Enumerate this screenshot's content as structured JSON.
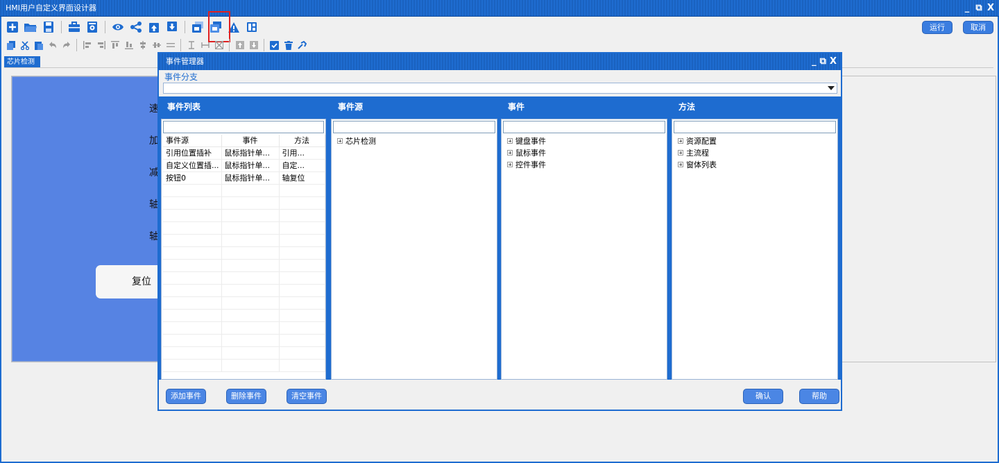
{
  "window": {
    "title": "HMI用户自定义界面设计器"
  },
  "window_controls": {
    "minimize": "_",
    "restore": "⧉",
    "close": "X"
  },
  "toolbar_top": {
    "buttons": [
      "new-icon",
      "open-folder-icon",
      "save-icon",
      "toolbox-icon",
      "document-settings-icon",
      "preview-eye-icon",
      "share-icon",
      "upload-icon",
      "download-icon",
      "layer-front-icon",
      "layer-back-icon",
      "warning-icon",
      "layout-icon"
    ]
  },
  "toolbar_bottom": {
    "buttons": [
      "copy-icon",
      "cut-icon",
      "paste-icon",
      "undo-icon",
      "redo-icon",
      "align-left-icon",
      "align-right-icon",
      "align-top-icon",
      "align-bottom-icon",
      "align-vcenter-icon",
      "align-hcenter-icon",
      "distribute-h-icon",
      "same-height-icon",
      "same-width-icon",
      "same-size-icon",
      "bring-front-icon",
      "send-back-icon",
      "checklist-icon",
      "delete-icon",
      "tools-icon"
    ]
  },
  "actions": {
    "run": "运行",
    "cancel": "取消"
  },
  "doc_tab": {
    "label": "芯片检测"
  },
  "canvas": {
    "labels": [
      "速",
      "加",
      "减",
      "轴",
      "轴"
    ],
    "reset_button": "复位"
  },
  "dialog": {
    "title": "事件管理器",
    "branch_label": "事件分支",
    "branch_value": "",
    "panels": {
      "event_list": "事件列表",
      "event_source": "事件源",
      "event": "事件",
      "method": "方法"
    },
    "table": {
      "headers": [
        "事件源",
        "事件",
        "方法"
      ],
      "rows": [
        [
          "引用位置插补",
          "鼠标指针单...",
          "引用..."
        ],
        [
          "自定义位置插...",
          "鼠标指针单...",
          "自定..."
        ],
        [
          "按钮0",
          "鼠标指针单...",
          "轴复位"
        ]
      ]
    },
    "source_tree": [
      "芯片检测"
    ],
    "event_tree": [
      "键盘事件",
      "鼠标事件",
      "控件事件"
    ],
    "method_tree": [
      "资源配置",
      "主流程",
      "窗体列表"
    ],
    "buttons": {
      "add": "添加事件",
      "delete": "删除事件",
      "clear": "清空事件",
      "ok": "确认",
      "help": "帮助"
    }
  }
}
